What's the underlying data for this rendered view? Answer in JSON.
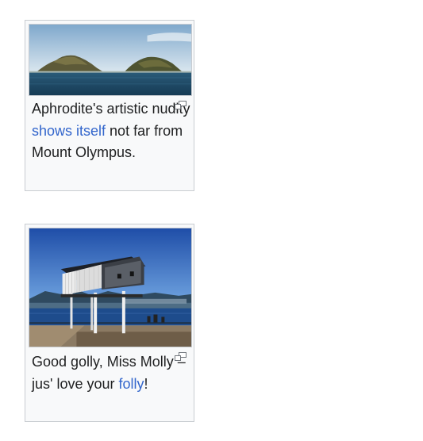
{
  "gallery": {
    "items": [
      {
        "image_alt": "Islands off the coast with sea in the foreground",
        "caption_before": "Aphrodite's artistic nudity ",
        "caption_link": "shows itself",
        "caption_after": " not far from Mount Olympus.",
        "magnify_icon": "magnify-clip-icon"
      },
      {
        "image_alt": "White house on stilts at a waterfront promenade",
        "caption_before": "Good golly, Miss Molly – jus' love your ",
        "caption_link": "folly",
        "caption_after": "!",
        "magnify_icon": "magnify-clip-icon"
      }
    ]
  },
  "colors": {
    "link": "#3366cc",
    "text": "#202122",
    "frame_border": "#c8ccd1",
    "frame_background": "#f8f9fa"
  }
}
